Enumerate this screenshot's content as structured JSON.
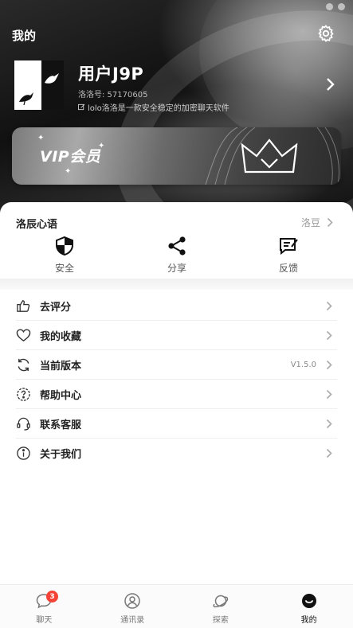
{
  "header": {
    "title": "我的",
    "settings_icon": "gear-icon"
  },
  "profile": {
    "username": "用户J9P",
    "lolo_id": "洛洛号: 57170605",
    "description": "lolo洛洛是一款安全稳定的加密聊天软件"
  },
  "vip": {
    "label": "VIP会员"
  },
  "mood": {
    "title": "洛辰心语",
    "right_label": "洛豆"
  },
  "quick_actions": [
    {
      "label": "安全",
      "icon": "shield-icon"
    },
    {
      "label": "分享",
      "icon": "share-icon"
    },
    {
      "label": "反馈",
      "icon": "feedback-icon"
    }
  ],
  "menu": [
    {
      "label": "去评分",
      "icon": "thumbs-up-icon",
      "value": ""
    },
    {
      "label": "我的收藏",
      "icon": "heart-icon",
      "value": ""
    },
    {
      "label": "当前版本",
      "icon": "refresh-icon",
      "value": "V1.5.0"
    },
    {
      "label": "帮助中心",
      "icon": "help-icon",
      "value": ""
    },
    {
      "label": "联系客服",
      "icon": "headset-icon",
      "value": ""
    },
    {
      "label": "关于我们",
      "icon": "info-icon",
      "value": ""
    }
  ],
  "nav": {
    "tabs": [
      {
        "label": "聊天",
        "icon": "chat-icon"
      },
      {
        "label": "通讯录",
        "icon": "contacts-icon"
      },
      {
        "label": "探索",
        "icon": "planet-icon"
      },
      {
        "label": "我的",
        "icon": "profile-icon"
      }
    ],
    "chat_badge": "3",
    "active_tab": "我的"
  },
  "colors": {
    "accent": "#111111",
    "badge": "#f44336",
    "muted": "#9a9a9a"
  }
}
